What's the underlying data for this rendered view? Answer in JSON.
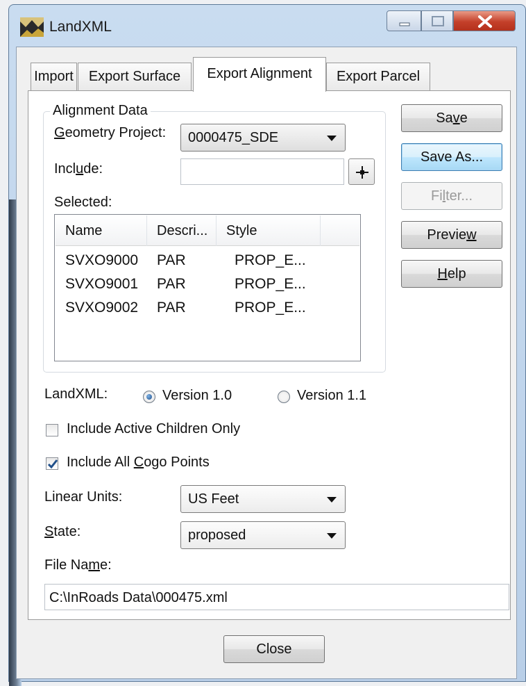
{
  "window": {
    "title": "LandXML",
    "icon": "landxml-app-icon",
    "controls": [
      "minimize-icon",
      "maximize-icon",
      "close-icon"
    ]
  },
  "tabs": [
    {
      "label": "Import",
      "active": false
    },
    {
      "label": "Export Surface",
      "active": false
    },
    {
      "label": "Export Alignment",
      "active": true
    },
    {
      "label": "Export Parcel",
      "active": false
    }
  ],
  "alignment_group": {
    "legend": "Alignment Data",
    "geometry_project": {
      "label_pre": "",
      "label_key": "G",
      "label_post": "eometry Project:",
      "value": "0000475_SDE"
    },
    "include": {
      "label_pre": "Incl",
      "label_key": "u",
      "label_post": "de:",
      "value": "",
      "pick_icon": "crosshair-pick-icon"
    },
    "selected_label": "Selected:",
    "list": {
      "columns": [
        "Name",
        "Descri...",
        "Style"
      ],
      "rows": [
        [
          "SVXO9000",
          "PAR",
          "PROP_E..."
        ],
        [
          "SVXO9001",
          "PAR",
          "PROP_E..."
        ],
        [
          "SVXO9002",
          "PAR",
          "PROP_E..."
        ]
      ]
    }
  },
  "landxml_version": {
    "label": "LandXML:",
    "options": [
      {
        "label": "Version 1.0",
        "selected": true
      },
      {
        "label": "Version 1.1",
        "selected": false
      }
    ]
  },
  "options": {
    "active_children": {
      "label": "Include Active Children Only",
      "checked": false
    },
    "cogo_points": {
      "label_pre": "Include All ",
      "label_key": "C",
      "label_post": "ogo Points",
      "checked": true
    }
  },
  "linear_units": {
    "label": "Linear Units:",
    "value": "US Feet"
  },
  "state": {
    "label_key": "S",
    "label_post": "tate:",
    "value": "proposed"
  },
  "file_name": {
    "label_pre": "File Na",
    "label_key": "m",
    "label_post": "e:",
    "value": "C:\\InRoads Data\\000475.xml"
  },
  "buttons": {
    "save": {
      "pre": "Sa",
      "key": "v",
      "post": "e"
    },
    "save_as": "Save As...",
    "filter": {
      "pre": "Fi",
      "key": "l",
      "post": "ter..."
    },
    "preview": {
      "pre": "Previe",
      "key": "w",
      "post": ""
    },
    "help": {
      "pre": "",
      "key": "H",
      "post": "elp"
    },
    "close": "Close"
  },
  "colors": {
    "title_bar": "#b9cfe8",
    "close_button": "#c4402a",
    "focus_blue": "#3c7fb1",
    "panel": "#ffffff"
  }
}
